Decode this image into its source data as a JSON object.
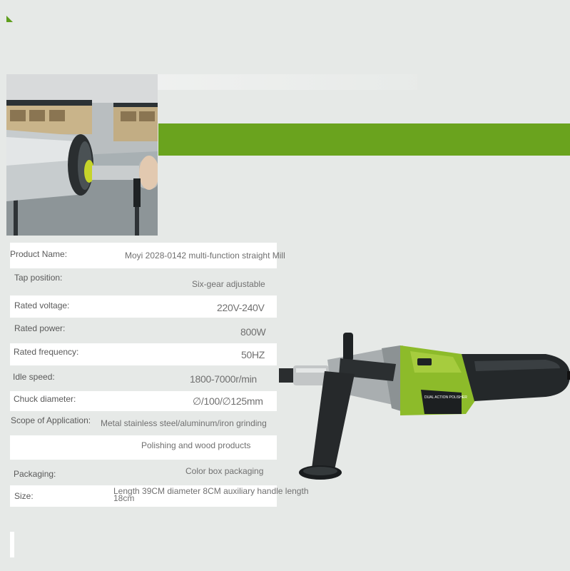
{
  "specs": {
    "product_name": {
      "label": "Product Name:",
      "value": "Moyi 2028-0142 multi-function straight Mill"
    },
    "tap_position": {
      "label": "Tap position:",
      "value": "Six-gear adjustable"
    },
    "rated_voltage": {
      "label": "Rated voltage:",
      "value": "220V-240V"
    },
    "rated_power": {
      "label": "Rated power:",
      "value": "800W"
    },
    "rated_frequency": {
      "label": "Rated frequency:",
      "value": "50HZ"
    },
    "idle_speed": {
      "label": "Idle speed:",
      "value": "1800-7000r/min"
    },
    "chuck_diameter": {
      "label": "Chuck diameter:",
      "value": "∅/100/∅125mm"
    },
    "scope": {
      "label": "Scope of Application:",
      "value": "Metal stainless steel/aluminum/iron grinding",
      "value2": "Polishing and wood products"
    },
    "packaging": {
      "label": "Packaging:",
      "value": "Color box packaging"
    },
    "size": {
      "label": "Size:",
      "value": "Length 39CM diameter 8CM auxiliary handle length 18cm"
    }
  },
  "tool_label": {
    "line1": "DUAL ACTION POLISHER"
  },
  "colors": {
    "accent_green": "#6aa31e",
    "background": "#e6e9e7"
  }
}
